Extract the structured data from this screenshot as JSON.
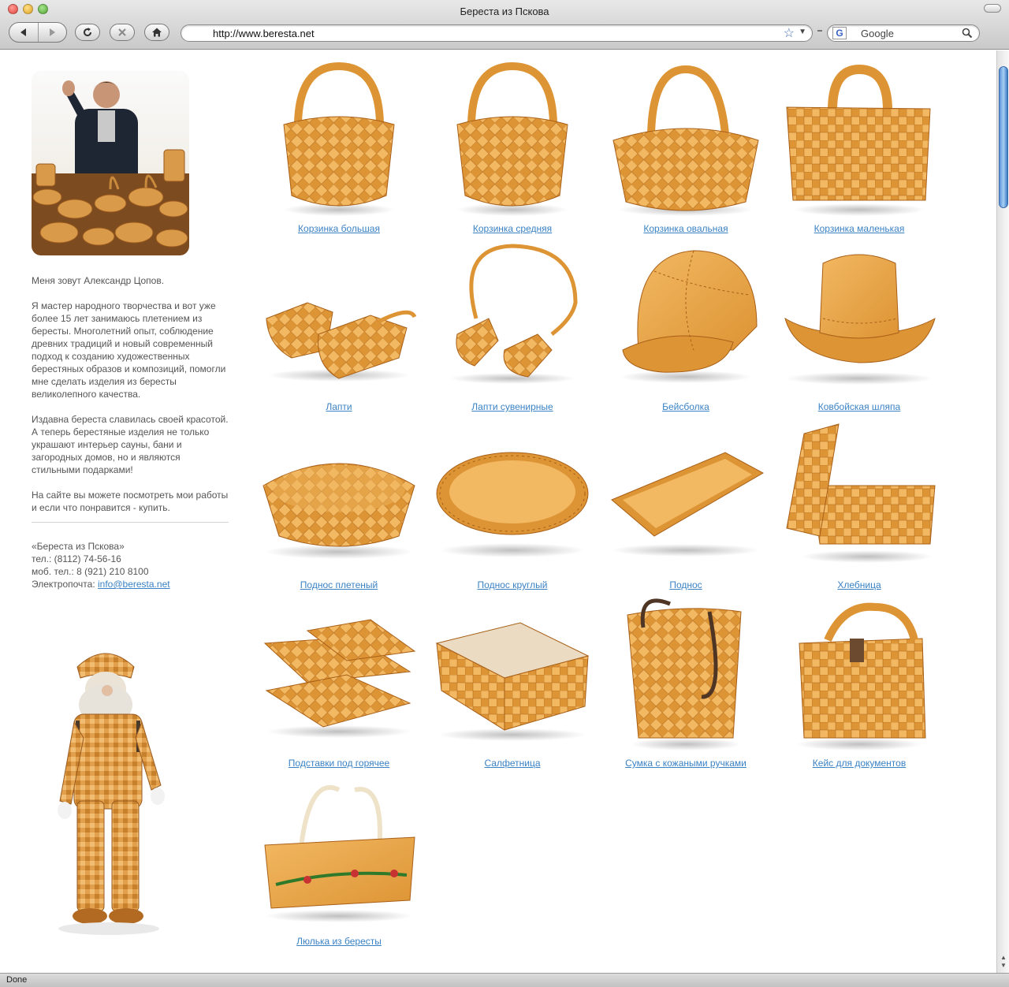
{
  "browser": {
    "title": "Береста из Пскова",
    "url": "http://www.beresta.net",
    "search_placeholder": "Google",
    "search_engine_logo": "G",
    "status": "Done"
  },
  "sidebar": {
    "intro": "Меня зовут Александр Цопов.",
    "paragraph1": "Я мастер народного творчества и вот уже более 15 лет занимаюсь плетением из бересты. Многолетний опыт, соблюдение древних традиций и новый современный подход к созданию художественных берестяных образов и композиций, помогли мне сделать изделия из бересты великолепного качества.",
    "paragraph2": "Издавна береста славилась своей красотой. А теперь берестяные изделия не только украшают интерьер сауны, бани и загородных домов, но и являются стильными подарками!",
    "paragraph3": "На сайте вы можете посмотреть мои работы и если что понравится - купить.",
    "contacts": {
      "company": "«Береста из Пскова»",
      "phone": "тел.: (8112) 74-56-16",
      "mobile": "моб. тел.: 8 (921) 210 8100",
      "email_label": "Электропочта: ",
      "email": "info@beresta.net"
    }
  },
  "products": [
    {
      "label": "Корзинка большая",
      "kind": "basket"
    },
    {
      "label": "Корзинка средняя",
      "kind": "basket"
    },
    {
      "label": "Корзинка овальная",
      "kind": "basket-oval"
    },
    {
      "label": "Корзинка маленькая",
      "kind": "basket-square"
    },
    {
      "label": "Лапти",
      "kind": "shoes"
    },
    {
      "label": "Лапти сувенирные",
      "kind": "shoes-souvenir"
    },
    {
      "label": "Бейсболка",
      "kind": "cap"
    },
    {
      "label": "Ковбойская шляпа",
      "kind": "hat"
    },
    {
      "label": "Поднос плетеный",
      "kind": "tray-woven"
    },
    {
      "label": "Поднос круглый",
      "kind": "tray-round"
    },
    {
      "label": "Поднос",
      "kind": "tray"
    },
    {
      "label": "Хлебница",
      "kind": "breadbox"
    },
    {
      "label": "Подставки под горячее",
      "kind": "coasters"
    },
    {
      "label": "Салфетница",
      "kind": "napkin-box"
    },
    {
      "label": "Сумка с кожаными ручками",
      "kind": "bag"
    },
    {
      "label": "Кейс для документов",
      "kind": "case"
    },
    {
      "label": "Люлька из бересты",
      "kind": "cradle"
    }
  ],
  "colors": {
    "link": "#3a82c4",
    "text": "#555555",
    "birch_light": "#f2b862",
    "birch_mid": "#dd9434",
    "birch_dark": "#a85f17"
  }
}
